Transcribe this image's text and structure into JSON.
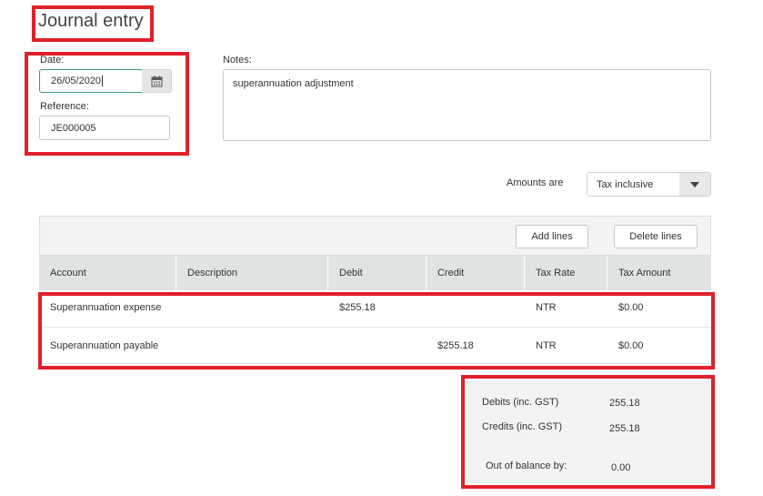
{
  "header": {
    "title": "Journal entry"
  },
  "form": {
    "date_label": "Date:",
    "date_value": "26/05/2020",
    "reference_label": "Reference:",
    "reference_value": "JE000005",
    "notes_label": "Notes:",
    "notes_value": "superannuation adjustment",
    "amounts_are_label": "Amounts are",
    "amounts_are_value": "Tax inclusive"
  },
  "toolbar": {
    "add_lines_label": "Add lines",
    "delete_lines_label": "Delete lines"
  },
  "table": {
    "columns": [
      "Account",
      "Description",
      "Debit",
      "Credit",
      "Tax Rate",
      "Tax Amount"
    ],
    "rows": [
      {
        "account": "Superannuation expense",
        "description": "",
        "debit": "$255.18",
        "credit": "",
        "tax_rate": "NTR",
        "tax_amount": "$0.00"
      },
      {
        "account": "Superannuation payable",
        "description": "",
        "debit": "",
        "credit": "$255.18",
        "tax_rate": "NTR",
        "tax_amount": "$0.00"
      }
    ]
  },
  "summary": {
    "debits_label": "Debits (inc. GST)",
    "debits_value": "255.18",
    "credits_label": "Credits (inc. GST)",
    "credits_value": "255.18",
    "balance_label": "Out of balance by:",
    "balance_value": "0.00"
  },
  "colors": {
    "highlight_border": "#e0202a",
    "focus_border": "#3a9e6e",
    "table_header": "#dfe3e4"
  },
  "icons": {
    "calendar": "calendar-icon",
    "dropdown": "caret-down-icon"
  }
}
